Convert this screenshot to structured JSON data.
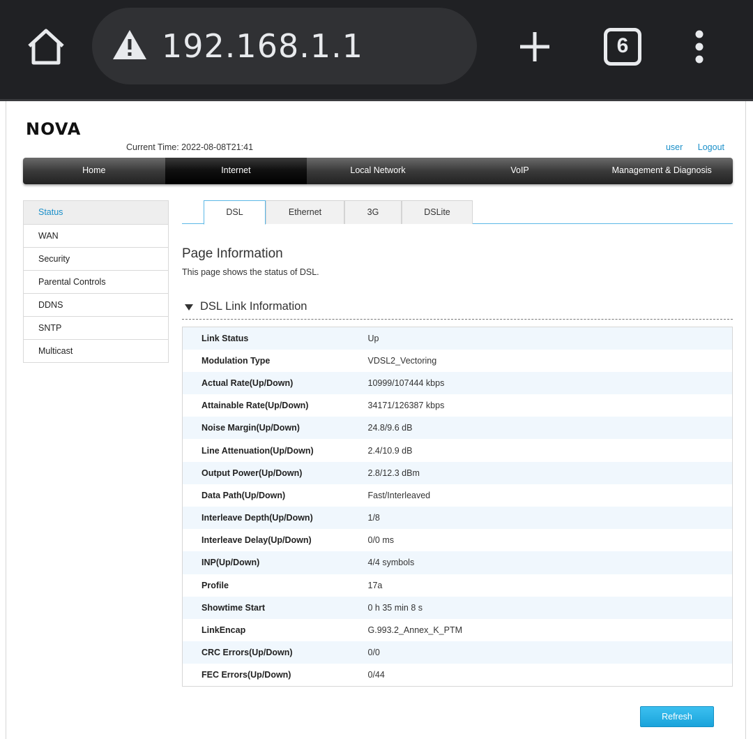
{
  "browser": {
    "url": "192.168.1.1",
    "tab_count": "6"
  },
  "header": {
    "logo": "NOVA",
    "current_time": "Current Time: 2022-08-08T21:41",
    "user_label": "user",
    "logout_label": "Logout"
  },
  "topnav": [
    "Home",
    "Internet",
    "Local Network",
    "VoIP",
    "Management & Diagnosis"
  ],
  "sidenav": [
    "Status",
    "WAN",
    "Security",
    "Parental Controls",
    "DDNS",
    "SNTP",
    "Multicast"
  ],
  "subtabs": [
    "DSL",
    "Ethernet",
    "3G",
    "DSLite"
  ],
  "page_info": {
    "title": "Page Information",
    "description": "This page shows the status of DSL."
  },
  "section": {
    "title": "DSL Link Information"
  },
  "rows": [
    {
      "label": "Link Status",
      "value": "Up"
    },
    {
      "label": "Modulation Type",
      "value": "VDSL2_Vectoring"
    },
    {
      "label": "Actual Rate(Up/Down)",
      "value": "10999/107444 kbps"
    },
    {
      "label": "Attainable Rate(Up/Down)",
      "value": "34171/126387 kbps"
    },
    {
      "label": "Noise Margin(Up/Down)",
      "value": "24.8/9.6 dB"
    },
    {
      "label": "Line Attenuation(Up/Down)",
      "value": "2.4/10.9 dB"
    },
    {
      "label": "Output Power(Up/Down)",
      "value": "2.8/12.3 dBm"
    },
    {
      "label": "Data Path(Up/Down)",
      "value": "Fast/Interleaved"
    },
    {
      "label": "Interleave Depth(Up/Down)",
      "value": "1/8"
    },
    {
      "label": "Interleave Delay(Up/Down)",
      "value": "0/0 ms"
    },
    {
      "label": "INP(Up/Down)",
      "value": "4/4 symbols"
    },
    {
      "label": "Profile",
      "value": "17a"
    },
    {
      "label": "Showtime Start",
      "value": "0 h 35 min 8 s"
    },
    {
      "label": "LinkEncap",
      "value": "G.993.2_Annex_K_PTM"
    },
    {
      "label": "CRC Errors(Up/Down)",
      "value": "0/0"
    },
    {
      "label": "FEC Errors(Up/Down)",
      "value": "0/44"
    }
  ],
  "refresh_label": "Refresh",
  "colors": {
    "accent": "#1a8fc9",
    "chrome_bg": "#202124",
    "row_alt": "#f0f7fd",
    "button": "#1aa3db"
  }
}
